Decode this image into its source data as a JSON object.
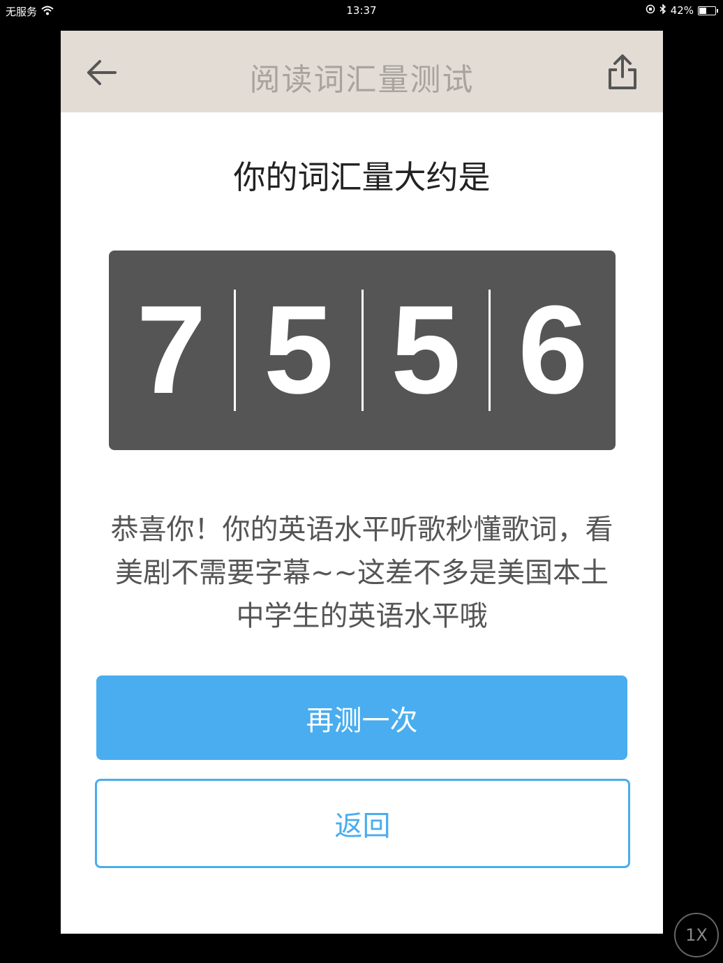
{
  "status_bar": {
    "carrier": "无服务",
    "time": "13:37",
    "battery_text": "42%",
    "battery_level": 0.42
  },
  "nav": {
    "title": "阅读词汇量测试",
    "back_icon": "back-arrow-icon",
    "share_icon": "share-icon"
  },
  "result": {
    "heading": "你的词汇量大约是",
    "digits": [
      "7",
      "5",
      "5",
      "6"
    ],
    "message": "恭喜你！你的英语水平听歌秒懂歌词，看美剧不需要字幕~~这差不多是美国本土中学生的英语水平哦"
  },
  "buttons": {
    "retest": "再测一次",
    "back": "返回"
  },
  "zoom": {
    "label": "1X"
  },
  "colors": {
    "nav_bg": "#e3dcd5",
    "counter_bg": "#555555",
    "accent": "#49adef"
  }
}
